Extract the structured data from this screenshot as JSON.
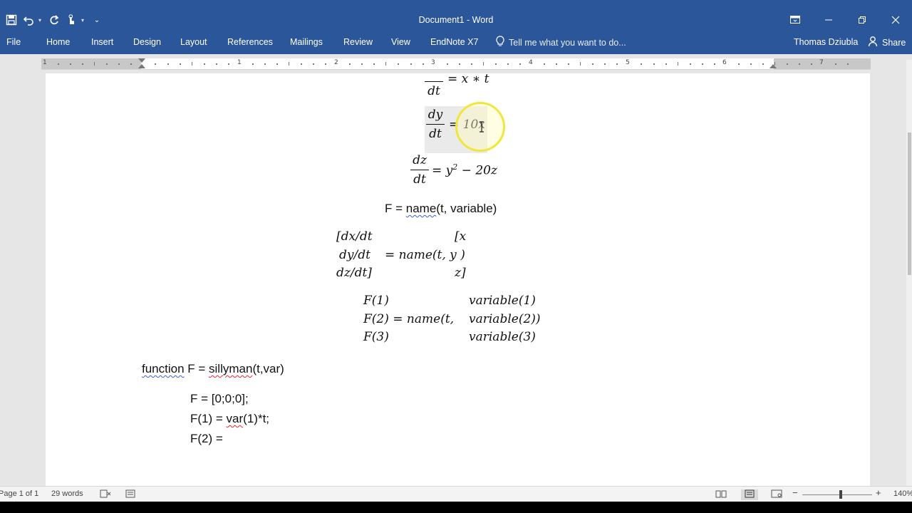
{
  "window": {
    "title": "Document1 - Word"
  },
  "ribbon": {
    "tabs": [
      "File",
      "Home",
      "Insert",
      "Design",
      "Layout",
      "References",
      "Mailings",
      "Review",
      "View",
      "EndNote X7"
    ],
    "tell_me_placeholder": "Tell me what you want to do...",
    "user_name": "Thomas Dziubla",
    "share_label": "Share"
  },
  "ruler": {
    "numbers": [
      "1",
      "1",
      "2",
      "3",
      "4",
      "5",
      "6",
      "7"
    ]
  },
  "document": {
    "eq1": {
      "den": "dt",
      "rhs": "= x ∗ t"
    },
    "eq2": {
      "num": "dy",
      "den": "dt",
      "rhs": "= 10x"
    },
    "eq3": {
      "num": "dz",
      "den": "dt",
      "rhs_pre": "= y",
      "exp": "2",
      "rhs_post": " − 20z"
    },
    "line_f": {
      "pre": "F = ",
      "link": "name",
      "post": "(t, variable)"
    },
    "matrix1": {
      "r1_left": "[dx/dt",
      "r1_right": "[x",
      "r2_left": "dy/dt",
      "r2_mid": "= name(t, y )",
      "r3_left": "dz/dt]",
      "r3_right": "z]"
    },
    "matrix2": {
      "r1_left": "F(1)",
      "r1_right": "variable(1)",
      "r2_left": "F(2) = name(t,",
      "r2_right": "variable(2))",
      "r3_left": "F(3)",
      "r3_right": "variable(3)"
    },
    "code": {
      "func_a": "function",
      "func_b": "  F = ",
      "func_c": "sillyman",
      "func_d": "(t,var)",
      "l1": "F = [0;0;0];",
      "l2_a": "F(1) = ",
      "l2_b": "var",
      "l2_c": "(1)*t;",
      "l3": "F(2) ="
    }
  },
  "statusbar": {
    "page": "Page 1 of 1",
    "words": "29 words",
    "zoom": "140%"
  },
  "colors": {
    "word_blue": "#2b579a",
    "highlight_ring": "#f1e63a",
    "spell_underline": "#e23",
    "grammar_underline": "#3a5fd0"
  }
}
